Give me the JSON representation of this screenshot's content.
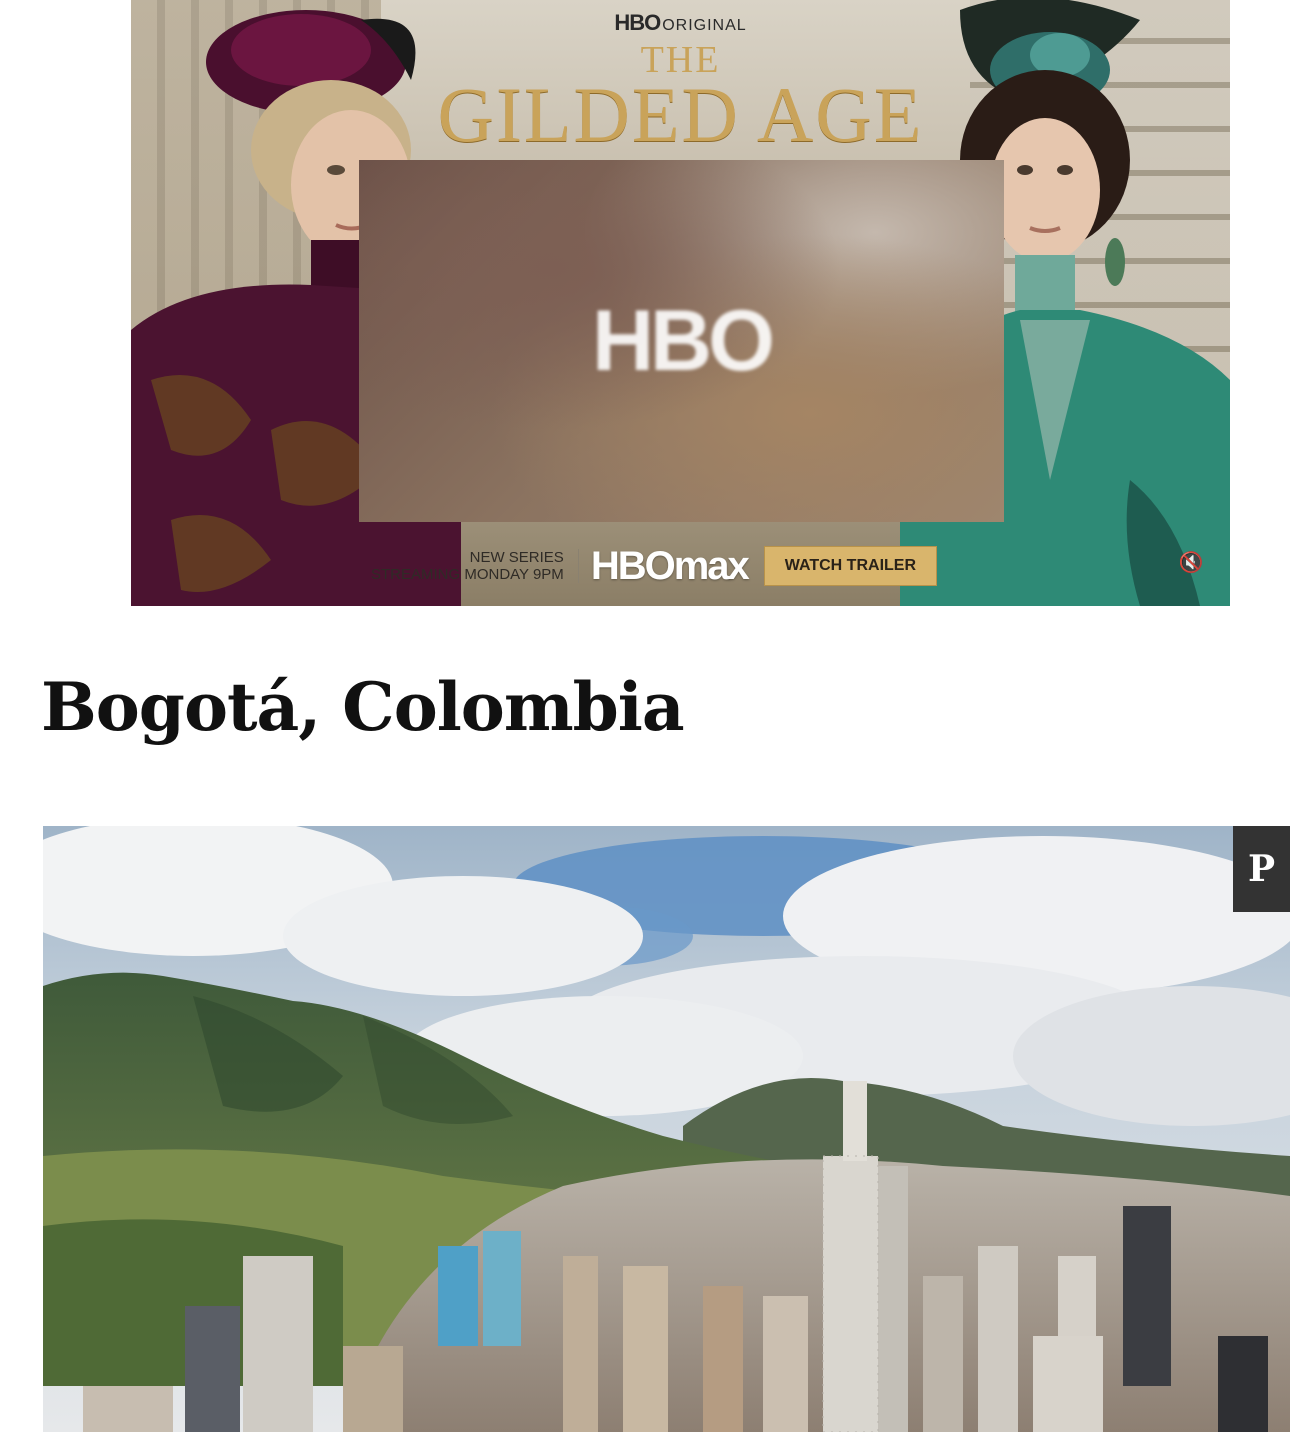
{
  "ad": {
    "network": "HBO",
    "network_suffix": "ORIGINAL",
    "title_prefix": "THE",
    "title": "GILDED AGE",
    "video_logo": "HBO",
    "stream_line1": "NEW SERIES",
    "stream_line2": "STREAMING MONDAY 9PM",
    "platform_logo": "HBOmax",
    "cta_label": "WATCH TRAILER",
    "mute_icon": "speaker-muted-icon"
  },
  "article": {
    "heading": "Bogotá, Colombia"
  },
  "photo": {
    "pin_icon": "pinterest-icon",
    "pin_glyph": "P"
  },
  "colors": {
    "gold": "#c9a35a",
    "cta_bg": "#d9b56c",
    "pin_bg": "#333333",
    "heading": "#111111"
  }
}
